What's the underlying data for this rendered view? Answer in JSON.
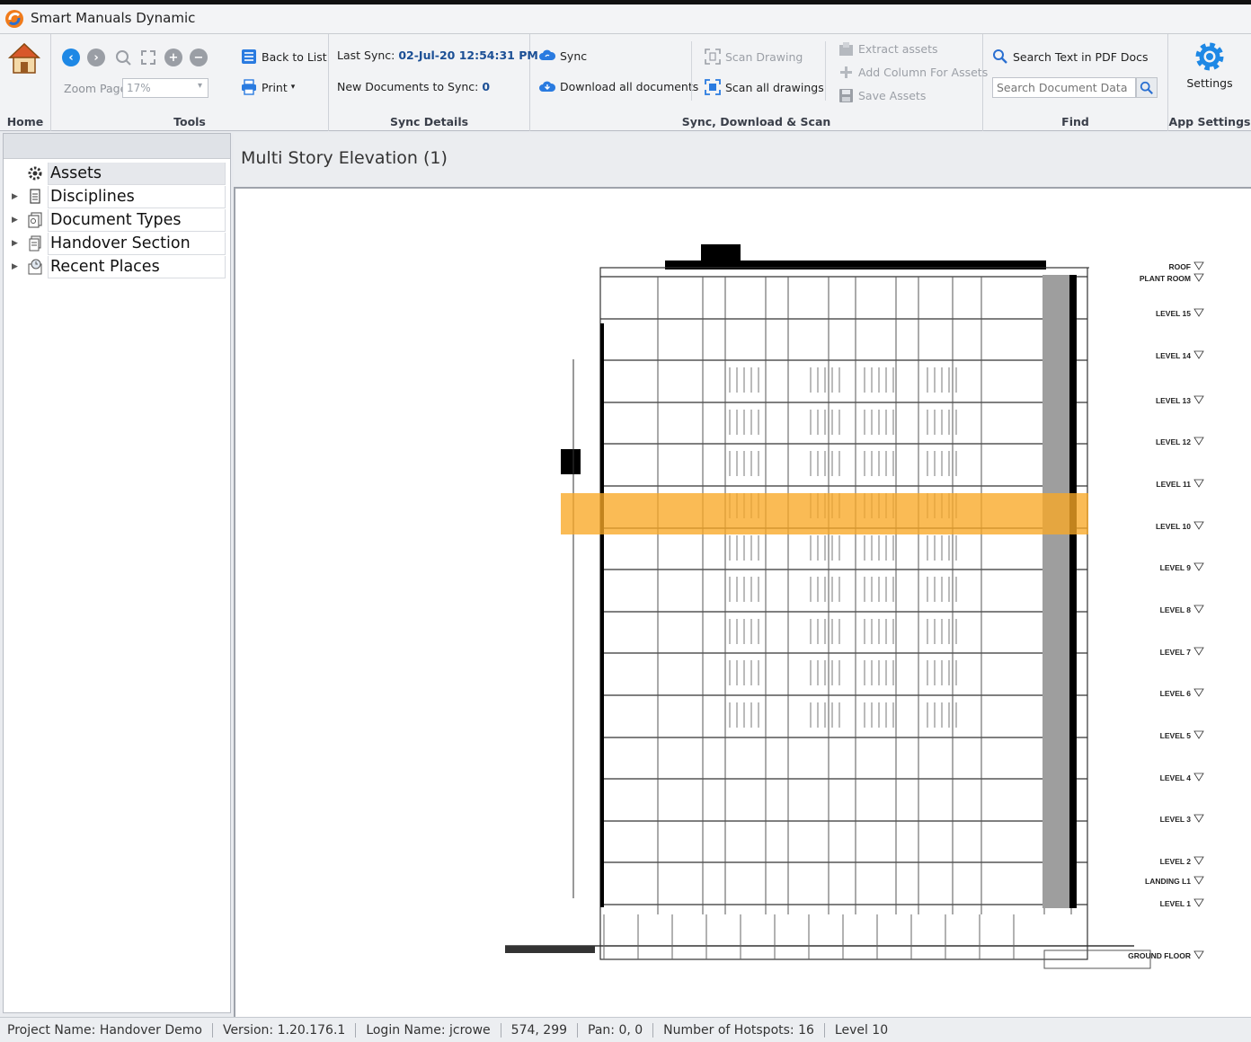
{
  "app": {
    "title": "Smart Manuals Dynamic"
  },
  "ribbon": {
    "home": {
      "group_label": "Home"
    },
    "tools": {
      "group_label": "Tools",
      "zoom_label": "Zoom Page",
      "zoom_value": "17%"
    },
    "list_print": {
      "back_to_list": "Back to List",
      "print": "Print"
    },
    "sync_details": {
      "group_label": "Sync Details",
      "last_sync_label": "Last Sync:",
      "last_sync_value": "02-Jul-20 12:54:31 PM",
      "new_docs_label": "New Documents to Sync:",
      "new_docs_value": "0"
    },
    "sync_download_scan": {
      "group_label": "Sync, Download & Scan",
      "sync": "Sync",
      "download_all": "Download all documents",
      "scan_drawing": "Scan Drawing",
      "scan_all": "Scan all drawings",
      "extract_assets": "Extract assets",
      "add_column": "Add Column For Assets",
      "save_assets": "Save Assets"
    },
    "find": {
      "group_label": "Find",
      "search_pdf": "Search Text in PDF Docs",
      "search_placeholder": "Search Document Data"
    },
    "app_settings": {
      "group_label": "App Settings",
      "settings": "Settings"
    }
  },
  "tree": {
    "items": [
      {
        "label": "Assets",
        "icon": "asset-gear-icon",
        "expandable": false,
        "selected": true
      },
      {
        "label": "Disciplines",
        "icon": "document-icon",
        "expandable": true
      },
      {
        "label": "Document Types",
        "icon": "document-types-icon",
        "expandable": true
      },
      {
        "label": "Handover Section",
        "icon": "handover-icon",
        "expandable": true
      },
      {
        "label": "Recent Places",
        "icon": "recent-places-icon",
        "expandable": true
      }
    ]
  },
  "document": {
    "title": "Multi Story Elevation (1)",
    "levels": [
      "ROOF",
      "PLANT ROOM",
      "LEVEL 15",
      "LEVEL 14",
      "LEVEL 13",
      "LEVEL 12",
      "LEVEL 11",
      "LEVEL 10",
      "LEVEL 9",
      "LEVEL 8",
      "LEVEL 7",
      "LEVEL 6",
      "LEVEL 5",
      "LEVEL 4",
      "LEVEL 3",
      "LEVEL 2",
      "LANDING L1",
      "LEVEL 1",
      "GROUND FLOOR"
    ],
    "highlighted_level": "LEVEL 10",
    "highlight_color": "#f9a825"
  },
  "statusbar": {
    "project": "Project Name: Handover Demo",
    "version": "Version: 1.20.176.1",
    "login": "Login Name: jcrowe",
    "cursor": "574, 299",
    "pan": "Pan: 0, 0",
    "hotspots": "Number of Hotspots: 16",
    "level": "Level 10"
  }
}
